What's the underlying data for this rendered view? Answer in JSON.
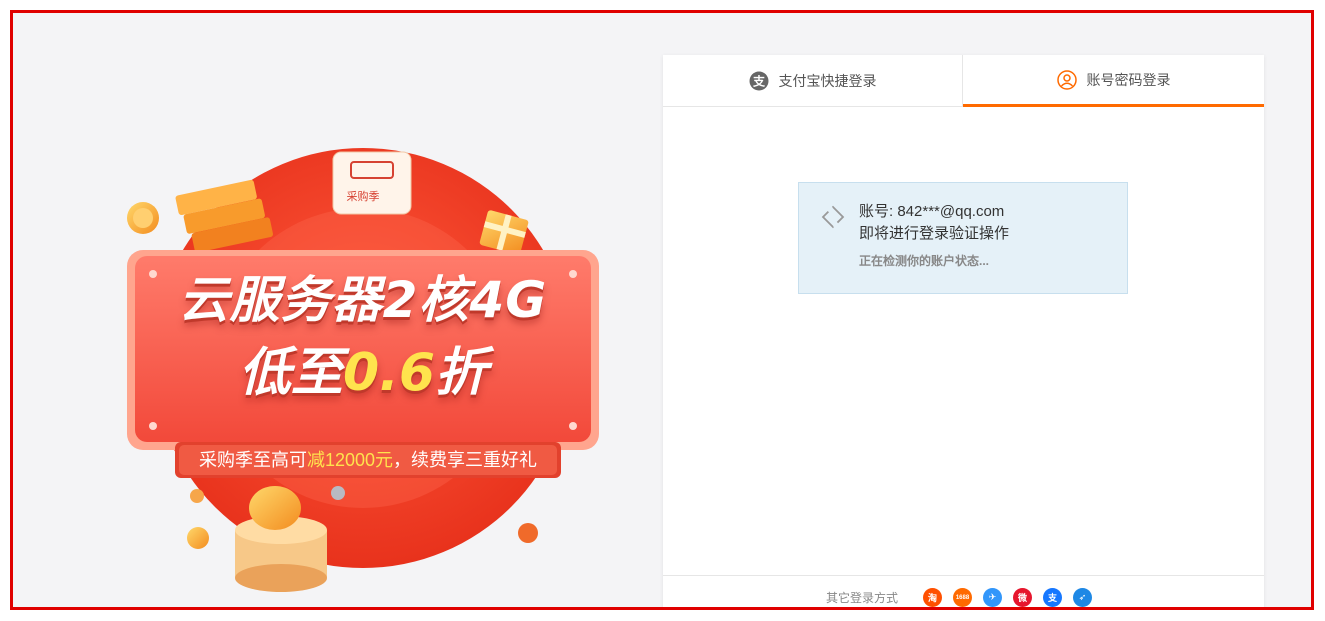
{
  "promo": {
    "badge": "采购季",
    "headline": "云服务器2核4G",
    "subline_prefix": "低至",
    "subline_highlight": "0.6",
    "subline_suffix": "折",
    "bar_prefix": "采购季至高可",
    "bar_highlight": "减12000元",
    "bar_suffix": "，续费享三重好礼"
  },
  "tabs": [
    {
      "label": "支付宝快捷登录",
      "icon": "alipay-icon",
      "active": false
    },
    {
      "label": "账号密码登录",
      "icon": "user-icon",
      "active": true
    }
  ],
  "verify": {
    "account": "账号: 842***@qq.com",
    "message": "即将进行登录验证操作",
    "status": "正在检测你的账户状态..."
  },
  "footer": {
    "label": "其它登录方式",
    "providers": [
      {
        "name": "taobao-icon",
        "glyph": "淘",
        "color": "#ff5000"
      },
      {
        "name": "1688-icon",
        "glyph": "1688",
        "color": "#ff6a00"
      },
      {
        "name": "dingtalk-icon",
        "glyph": "✈",
        "color": "#3296fa"
      },
      {
        "name": "weibo-icon",
        "glyph": "微",
        "color": "#e6162d"
      },
      {
        "name": "alipay-icon",
        "glyph": "支",
        "color": "#1677ff"
      },
      {
        "name": "feather-icon",
        "glyph": "➶",
        "color": "#1e88e5"
      }
    ]
  }
}
